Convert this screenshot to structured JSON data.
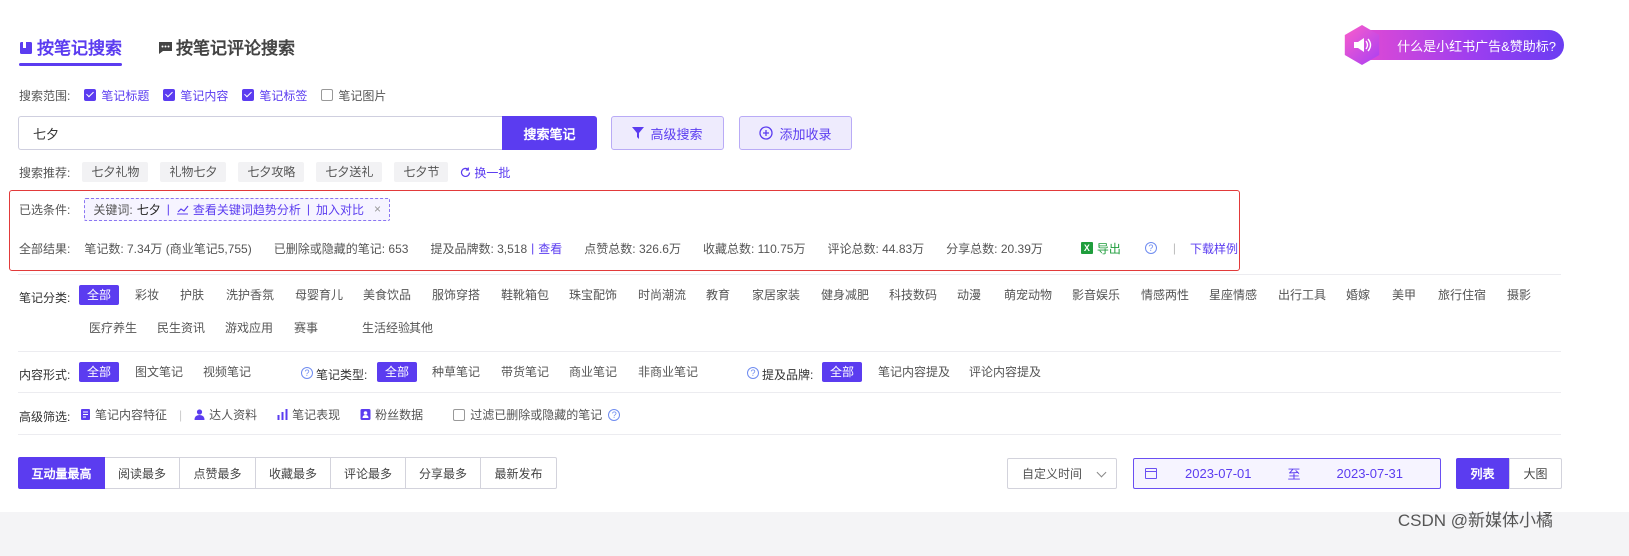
{
  "tabs": [
    {
      "label": "按笔记搜索",
      "active": true
    },
    {
      "label": "按笔记评论搜索",
      "active": false
    }
  ],
  "promo": {
    "label": "什么是小红书广告&赞助标?"
  },
  "scope": {
    "label": "搜索范围:",
    "options": [
      {
        "label": "笔记标题",
        "checked": true
      },
      {
        "label": "笔记内容",
        "checked": true
      },
      {
        "label": "笔记标签",
        "checked": true
      },
      {
        "label": "笔记图片",
        "checked": false
      }
    ]
  },
  "search": {
    "value": "七夕",
    "button": "搜索笔记",
    "advanced": "高级搜索",
    "add": "添加收录"
  },
  "recommend": {
    "label": "搜索推荐:",
    "tags": [
      "七夕礼物",
      "礼物七夕",
      "七夕攻略",
      "七夕送礼",
      "七夕节"
    ],
    "refresh": "换一批"
  },
  "selected": {
    "label": "已选条件:",
    "keyword_prefix": "关键词:",
    "keyword": "七夕",
    "trend_link": "查看关键词趋势分析",
    "compare_link": "加入对比",
    "separator": "|",
    "close": "×"
  },
  "results": {
    "label": "全部结果:",
    "notes": "笔记数: 7.34万 (商业笔记5,755)",
    "deleted": "已删除或隐藏的笔记: 653",
    "brands": "提及品牌数: 3,518",
    "brands_sep": "|",
    "view": "查看",
    "likes": "点赞总数: 326.6万",
    "collects": "收藏总数: 110.75万",
    "comments": "评论总数: 44.83万",
    "shares": "分享总数: 20.39万",
    "export": "导出",
    "help": "?",
    "divider": "|",
    "download": "下载样例"
  },
  "category": {
    "label": "笔记分类:",
    "items": [
      "全部",
      "彩妆",
      "护肤",
      "洗护香氛",
      "母婴育儿",
      "美食饮品",
      "服饰穿搭",
      "鞋靴箱包",
      "珠宝配饰",
      "时尚潮流",
      "教育",
      "家居家装",
      "健身减肥",
      "科技数码",
      "动漫",
      "萌宠动物",
      "影音娱乐",
      "情感两性",
      "星座情感",
      "出行工具",
      "婚嫁",
      "美甲",
      "旅行住宿",
      "摄影"
    ],
    "items2": [
      "医疗养生",
      "民生资讯",
      "游戏应用",
      "赛事",
      "生活经验",
      "其他"
    ]
  },
  "content_form": {
    "label": "内容形式:",
    "items": [
      "全部",
      "图文笔记",
      "视频笔记"
    ]
  },
  "note_type": {
    "label": "笔记类型:",
    "items": [
      "全部",
      "种草笔记",
      "带货笔记",
      "商业笔记",
      "非商业笔记"
    ]
  },
  "brand_mention": {
    "label": "提及品牌:",
    "items": [
      "全部",
      "笔记内容提及",
      "评论内容提及"
    ]
  },
  "advanced": {
    "label": "高级筛选:",
    "items": [
      "笔记内容特征",
      "达人资料",
      "笔记表现",
      "粉丝数据"
    ],
    "filter_deleted": "过滤已删除或隐藏的笔记"
  },
  "sort": {
    "items": [
      "互动量最高",
      "阅读最多",
      "点赞最多",
      "收藏最多",
      "评论最多",
      "分享最多",
      "最新发布"
    ]
  },
  "time": {
    "select": "自定义时间",
    "start": "2023-07-01",
    "to": "至",
    "end": "2023-07-31"
  },
  "view": {
    "list": "列表",
    "grid": "大图"
  },
  "watermark": "CSDN @新媒体小橘",
  "colors": {
    "accent": "#5b3cf0",
    "highlight_border": "#e23a3a",
    "excel_green": "#1f9d3c"
  }
}
